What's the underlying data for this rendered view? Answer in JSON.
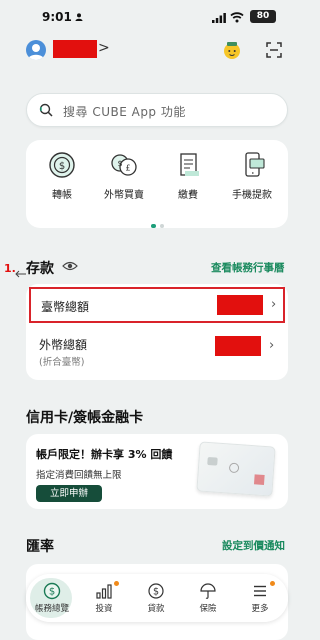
{
  "status_bar": {
    "time": "9:01",
    "battery": "80"
  },
  "header": {
    "name_chevron": ">"
  },
  "search": {
    "placeholder": "搜尋 CUBE App 功能"
  },
  "quick_actions": [
    {
      "label": "轉帳",
      "icon": "dollar-transfer-icon"
    },
    {
      "label": "外幣買賣",
      "icon": "currency-exchange-icon"
    },
    {
      "label": "繳費",
      "icon": "bill-icon"
    },
    {
      "label": "手機提款",
      "icon": "mobile-withdraw-icon"
    }
  ],
  "annotation": {
    "label": "1."
  },
  "deposits": {
    "title": "存款",
    "link": "查看帳務行事曆",
    "rows": [
      {
        "label": "臺幣總額",
        "sub": ""
      },
      {
        "label": "外幣總額",
        "sub": "(折合臺幣)"
      }
    ]
  },
  "credit_card": {
    "title": "信用卡/簽帳金融卡",
    "banner_main": "帳戶限定！辦卡享 3% 回饋",
    "banner_sub": "指定消費回饋無上限",
    "button": "立即申辦"
  },
  "fx": {
    "title": "匯率",
    "link": "設定到價通知"
  },
  "bottom_nav": [
    {
      "label": "帳務總覽",
      "icon": "dollar-circle-icon",
      "active": true
    },
    {
      "label": "投資",
      "icon": "chart-icon",
      "active": false
    },
    {
      "label": "貸款",
      "icon": "loan-icon",
      "active": false
    },
    {
      "label": "保險",
      "icon": "umbrella-icon",
      "active": false
    },
    {
      "label": "更多",
      "icon": "menu-icon",
      "active": false
    }
  ],
  "colors": {
    "accent": "#1a8a5e",
    "redaction": "#e2100e",
    "highlight_border": "#d9232a",
    "button_bg": "#164d3a"
  }
}
